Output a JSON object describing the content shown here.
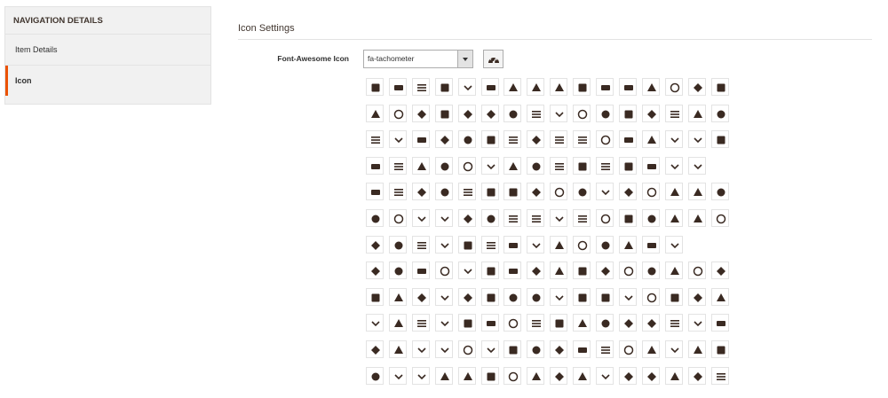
{
  "sidebar": {
    "title": "NAVIGATION DETAILS",
    "items": [
      {
        "label": "Item Details",
        "active": false
      },
      {
        "label": "Icon",
        "active": true
      }
    ]
  },
  "main": {
    "section_title": "Icon Settings",
    "field_label": "Font-Awesome Icon",
    "select_value": "fa-tachometer",
    "preview_icon": "tachometer-icon",
    "accent_color": "#eb5202"
  },
  "icon_grid": {
    "rows": [
      [
        "500px-icon",
        "adjust-icon",
        "adn-icon",
        "align-center-icon",
        "align-justify-icon",
        "align-left-icon",
        "align-right-icon",
        "amazon-icon",
        "ambulance-icon",
        "anchor-icon",
        "android-icon",
        "angellist-icon",
        "angle-double-down-icon",
        "angle-double-left-icon",
        "angle-double-right-icon",
        "angle-double-up-icon"
      ],
      [
        "angle-down-icon",
        "angle-left-icon",
        "angle-right-icon",
        "angle-up-icon",
        "apple-icon",
        "archive-icon",
        "area-chart-icon",
        "arrow-circle-down-icon",
        "arrow-circle-left-icon",
        "arrow-circle-o-down-icon",
        "arrow-circle-o-left-icon",
        "arrow-circle-o-right-icon",
        "arrow-circle-o-up-icon",
        "arrow-circle-right-icon",
        "arrow-circle-up-icon",
        "arrow-down-icon"
      ],
      [
        "arrow-left-icon",
        "arrow-right-icon",
        "arrow-up-icon",
        "arrows-icon",
        "arrows-alt-icon",
        "arrows-h-icon",
        "arrows-v-icon",
        "asterisk-icon",
        "at-icon",
        "backward-icon",
        "balance-scale-icon",
        "ban-icon",
        "bar-chart-icon",
        "barcode-icon",
        "bars-icon",
        "battery-empty-icon"
      ],
      [
        "battery-full-icon",
        "battery-half-icon",
        "battery-quarter-icon",
        "battery-three-quarters-icon",
        "bed-icon",
        "beer-icon",
        "behance-icon",
        "behance-square-icon",
        "bell-icon",
        "bell-o-icon",
        "bell-slash-icon",
        "bell-slash-o-icon",
        "bicycle-icon",
        "binoculars-icon",
        "birthday-cake-icon"
      ],
      [
        "bitbucket-icon",
        "bitbucket-square-icon",
        "black-tie-icon",
        "bluetooth-icon",
        "bluetooth-b-icon",
        "bold-icon",
        "bolt-icon",
        "bomb-icon",
        "book-icon",
        "bookmark-icon",
        "bookmark-o-icon",
        "briefcase-icon",
        "btc-icon",
        "bug-icon",
        "building-icon",
        "building-o-icon"
      ],
      [
        "bullhorn-icon",
        "bullseye-icon",
        "bus-icon",
        "buysellads-icon",
        "calculator-icon",
        "calendar-icon",
        "calendar-check-o-icon",
        "calendar-minus-o-icon",
        "calendar-o-icon",
        "calendar-plus-o-icon",
        "calendar-times-o-icon",
        "camera-icon",
        "camera-retro-icon",
        "car-icon",
        "caret-down-icon",
        "caret-left-icon"
      ],
      [
        "caret-right-icon",
        "caret-square-o-down-icon",
        "caret-square-o-left-icon",
        "caret-square-o-right-icon",
        "caret-up-icon",
        "cart-arrow-down-icon",
        "cart-plus-icon",
        "cc-icon",
        "cc-amex-icon",
        "cc-diners-club-icon",
        "cc-discover-icon",
        "cc-jcb-icon",
        "cc-mastercard-icon",
        "cc-paypal-icon"
      ],
      [
        "cc-stripe-icon",
        "cc-visa-icon",
        "certificate-icon",
        "chain-broken-icon",
        "check-icon",
        "check-circle-icon",
        "check-circle-o-icon",
        "check-square-icon",
        "check-square-o-icon",
        "chevron-circle-down-icon",
        "chevron-circle-left-icon",
        "chevron-circle-right-icon",
        "chevron-circle-up-icon",
        "chevron-down-icon",
        "chevron-left-icon",
        "chevron-right-icon"
      ],
      [
        "chevron-up-icon",
        "child-icon",
        "chrome-icon",
        "circle-icon",
        "circle-o-icon",
        "circle-o-notch-icon",
        "circle-thin-icon",
        "clipboard-icon",
        "clock-o-icon",
        "clone-icon",
        "cloud-icon",
        "cloud-download-icon",
        "cloud-upload-icon",
        "code-icon",
        "code-fork-icon",
        "codepen-icon"
      ],
      [
        "codiepie-icon",
        "coffee-icon",
        "cog-icon",
        "cogs-icon",
        "columns-icon",
        "comment-icon",
        "comment-o-icon",
        "commenting-icon",
        "commenting-o-icon",
        "comments-icon",
        "comments-o-icon",
        "compass-icon",
        "compress-icon",
        "connectdevelop-icon",
        "contao-icon",
        "copyright-icon"
      ],
      [
        "creative-commons-icon",
        "credit-card-icon",
        "credit-card-alt-icon",
        "crop-icon",
        "crosshairs-icon",
        "css3-icon",
        "cube-icon",
        "cubes-icon",
        "cutlery-icon",
        "dashcube-icon",
        "database-icon",
        "delicious-icon",
        "desktop-icon",
        "deviantart-icon",
        "diamond-icon",
        "digg-icon"
      ],
      [
        "dot-circle-o-icon",
        "download-icon",
        "dribbble-icon",
        "dropbox-icon",
        "drupal-icon",
        "edge-icon",
        "eject-icon",
        "ellipsis-h-icon",
        "ellipsis-v-icon",
        "empire-icon",
        "envelope-icon",
        "envelope-o-icon",
        "envelope-square-icon",
        "eraser-icon",
        "eur-icon",
        "exchange-icon"
      ]
    ]
  }
}
